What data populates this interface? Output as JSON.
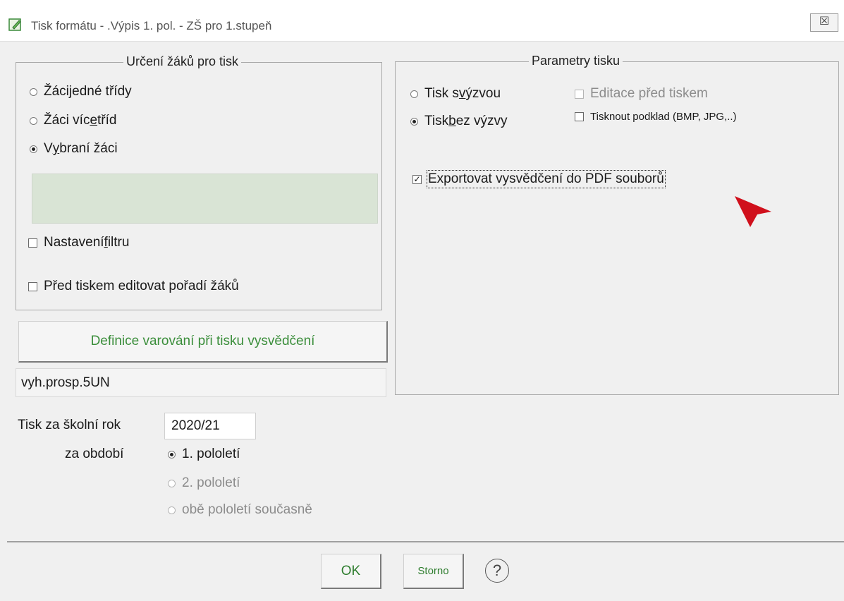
{
  "window": {
    "title": "Tisk formátu - .Výpis 1. pol. - ZŠ  pro 1.stupeň",
    "close_glyph": "☒"
  },
  "students_group": {
    "title": "Určení žáků pro tisk",
    "radios": [
      {
        "pre": "Žáci ",
        "ul": "j",
        "post": "edné třídy",
        "checked": false
      },
      {
        "pre": "Žáci víc",
        "ul": "e",
        "post": " tříd",
        "checked": false
      },
      {
        "pre": "V",
        "ul": "y",
        "post": "braní žáci",
        "checked": true
      }
    ],
    "filter_checkbox": {
      "pre": "Nastavení ",
      "ul": "f",
      "post": "iltru",
      "checked": false
    },
    "order_checkbox": {
      "label": "Před tiskem editovat pořadí žáků",
      "checked": false
    }
  },
  "print_params_group": {
    "title": "Parametry tisku",
    "radio_prompt": {
      "pre": "Tisk s ",
      "ul": "v",
      "post": "ýzvou",
      "checked": false
    },
    "radio_no_prompt": {
      "pre": "Tisk ",
      "ul": "b",
      "post": "ez výzvy",
      "checked": true
    },
    "edit_before_print": {
      "label": "Editace před tiskem",
      "checked": false,
      "disabled": true
    },
    "print_background": {
      "label": "Tisknout podklad (BMP, JPG,..)",
      "checked": false
    },
    "export_pdf": {
      "label": "Exportovat vysvědčení do PDF souborů",
      "checked": true
    }
  },
  "warning_button": {
    "label": "Definice varování při tisku vysvědčení"
  },
  "warning_value": "vyh.prosp.5UN",
  "school_year": {
    "label": "Tisk za školní rok",
    "value": "2020/21"
  },
  "period": {
    "label": "za období",
    "options": [
      {
        "label": "1. pololetí",
        "checked": true,
        "disabled": false
      },
      {
        "label": "2. pololetí",
        "checked": false,
        "disabled": true
      },
      {
        "label": "obě pololetí současně",
        "checked": false,
        "disabled": true
      }
    ]
  },
  "buttons": {
    "ok": "OK",
    "cancel": "Storno",
    "help": "?"
  },
  "colors": {
    "accent_green": "#3b8e3b",
    "filter_box": "#d9e4d5",
    "cursor_red": "#d0101c"
  }
}
